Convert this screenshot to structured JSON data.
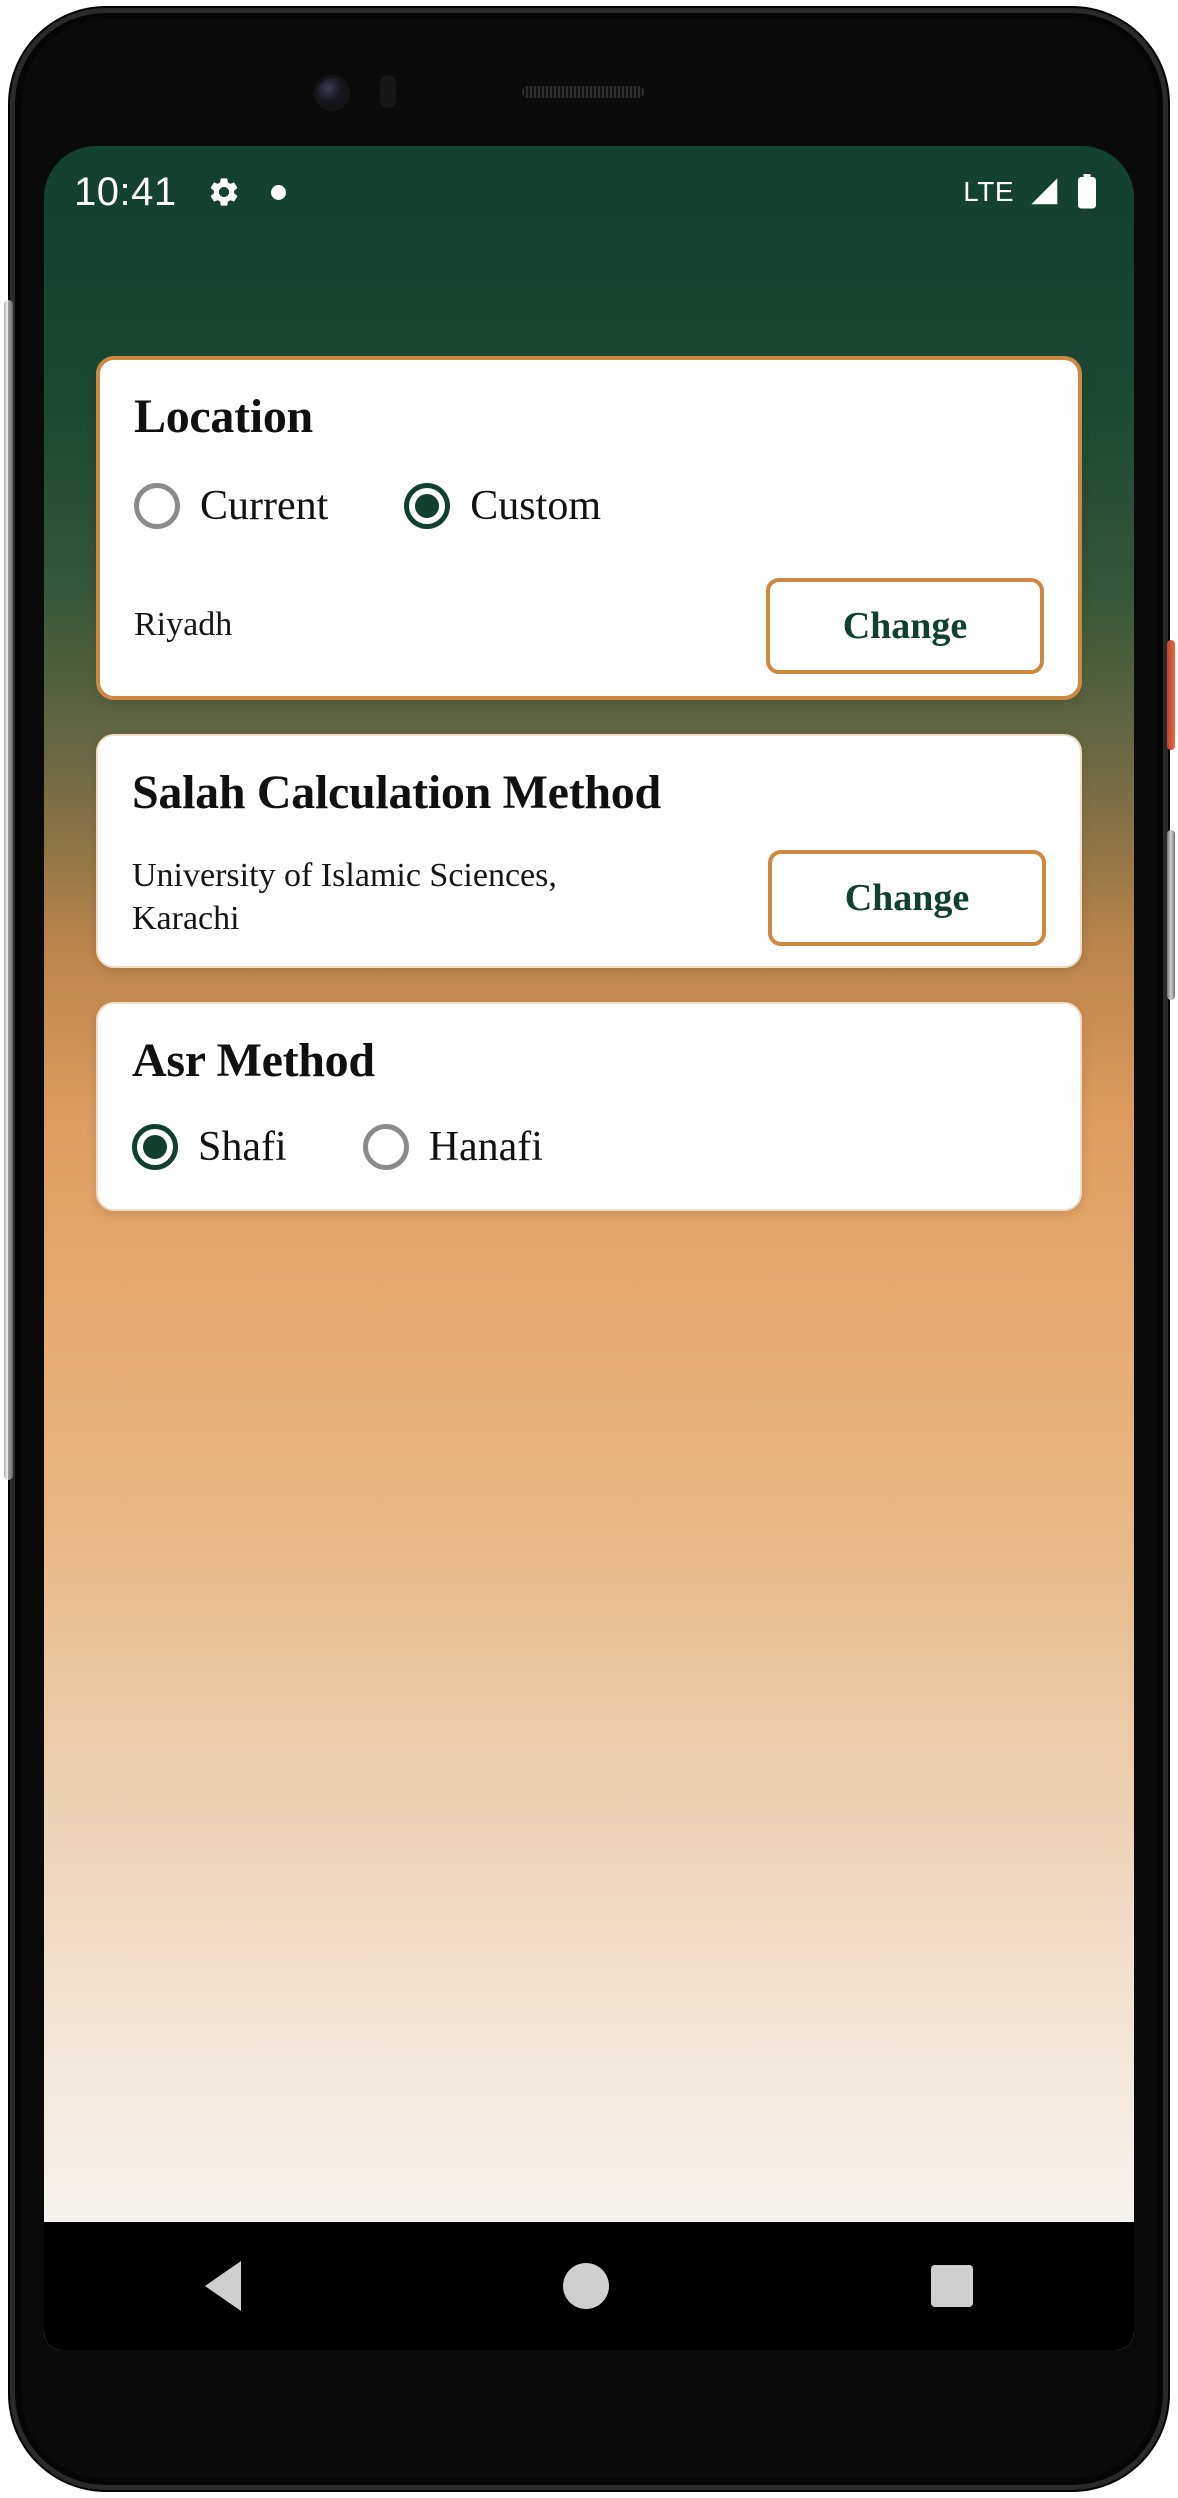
{
  "status_bar": {
    "clock": "10:41",
    "gear_icon": "gear-icon",
    "dot_icon": "dot-icon",
    "network_label": "LTE",
    "signal_icon": "signal-bars-icon",
    "battery_icon": "battery-full-icon"
  },
  "theme": {
    "header_green": "#12412f",
    "accent_orange": "#cf8840",
    "accent_green": "#11402f",
    "card_background": "#ffffff"
  },
  "cards": {
    "location": {
      "title": "Location",
      "options": [
        {
          "label": "Current",
          "selected": false
        },
        {
          "label": "Custom",
          "selected": true
        }
      ],
      "value": "Riyadh",
      "change_label": "Change"
    },
    "calculation_method": {
      "title": "Salah Calculation Method",
      "value": "University of Islamic Sciences, Karachi",
      "change_label": "Change"
    },
    "asr_method": {
      "title": "Asr Method",
      "options": [
        {
          "label": "Shafi",
          "selected": true
        },
        {
          "label": "Hanafi",
          "selected": false
        }
      ]
    }
  },
  "navigation_bar": {
    "back_label": "back-icon",
    "home_label": "home-icon",
    "recents_label": "recents-icon"
  }
}
